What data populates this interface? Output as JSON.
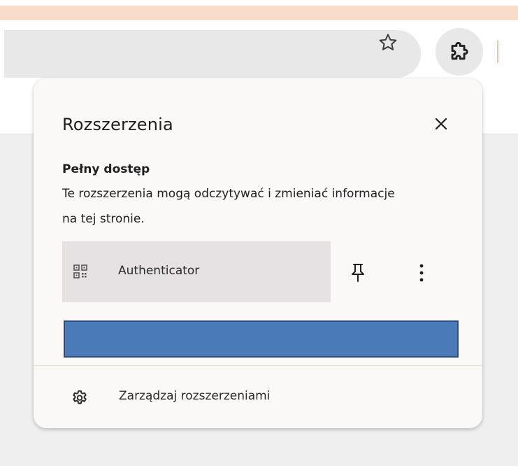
{
  "popup": {
    "title": "Rozszerzenia",
    "section_heading": "Pełny dostęp",
    "section_description": "Te rozszerzenia mogą odczytywać i zmieniać informacje na tej stronie.",
    "extensions": [
      {
        "name": "Authenticator",
        "icon": "qr-code-icon",
        "actions": [
          "pin-icon",
          "more-vert-icon"
        ]
      }
    ],
    "manage_label": "Zarządzaj rozszerzeniami",
    "manage_icon": "gear-icon",
    "close_icon": "close-icon"
  },
  "toolbar": {
    "bookmark_icon": "star-icon",
    "extensions_icon": "puzzle-icon"
  },
  "colors": {
    "top_strip": "#f9dcc9",
    "omnibox": "#e8e8e8",
    "popup_bg": "#fbf8f8",
    "extension_row_highlight": "#e6e2e3",
    "redaction_bar": "#4a7ab8",
    "page_bg": "#efefef"
  }
}
